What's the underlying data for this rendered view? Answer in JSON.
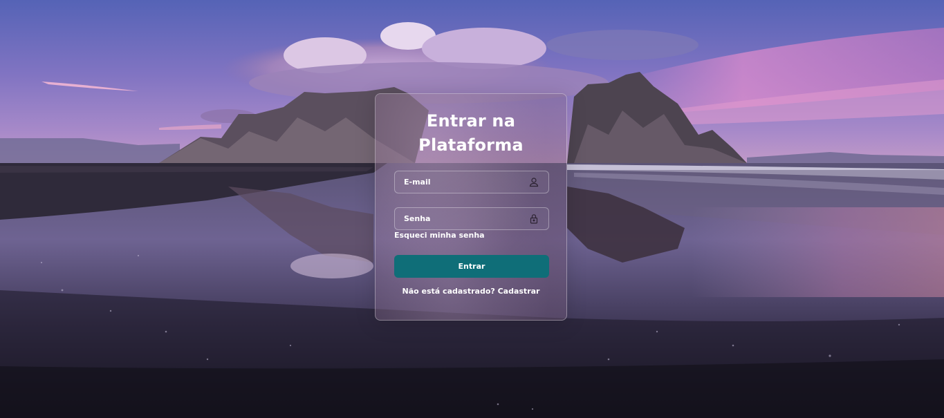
{
  "background": {
    "scene": "mountain-beach-sunset",
    "colors": {
      "sky_top": "#5d6ab8",
      "sky_mid": "#8a79c4",
      "sky_pink": "#d77fc6",
      "mountain": "#4a4048",
      "beach": "#2a2434"
    }
  },
  "login": {
    "title": "Entrar na Plataforma",
    "email": {
      "placeholder": "E-mail",
      "value": "",
      "icon": "user-icon"
    },
    "password": {
      "placeholder": "Senha",
      "value": "",
      "icon": "lock-icon"
    },
    "forgot_label": "Esqueci minha senha",
    "submit_label": "Entrar",
    "signup_prompt": "Não está cadastrado?",
    "signup_link": "Cadastrar",
    "colors": {
      "button": "#0f6e78",
      "text": "#ffffff"
    }
  }
}
